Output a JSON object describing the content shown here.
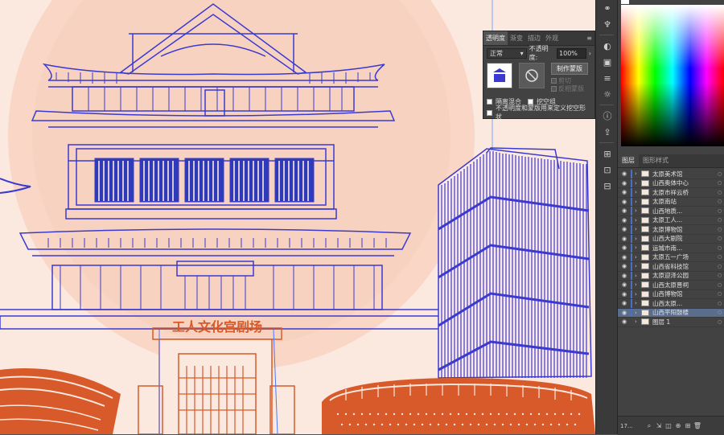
{
  "canvas": {
    "background": "#fbe8de",
    "sun_color": "#f9d6c5",
    "line_color": "#3a3ad0",
    "orange_color": "#d85a2a",
    "sign_text": "工人文化宫剧场"
  },
  "transparency_panel": {
    "tabs": [
      {
        "label": "透明度",
        "active": true
      },
      {
        "label": "渐变",
        "active": false
      },
      {
        "label": "描边",
        "active": false
      },
      {
        "label": "外观",
        "active": false
      }
    ],
    "menu_icon": "panel-menu-icon",
    "blend_mode": "正常",
    "opacity_label": "不透明度:",
    "opacity_value": "100%",
    "make_mask_label": "制作蒙版",
    "clip_label": "剪切",
    "invert_mask_label": "反相蒙版",
    "isolate_blending_label": "隔离混合",
    "knockout_group_label": "挖空组",
    "opacity_mask_define_label": "不透明度和蒙版用来定义挖空形状"
  },
  "toolbar": {
    "tools": [
      "link-icon",
      "puppet-icon",
      "color-icon",
      "swatch-icon",
      "stroke-icon",
      "sun-icon",
      "info-icon",
      "export-icon",
      "artboard-icon",
      "transform-icon",
      "align-icon"
    ]
  },
  "layers_panel": {
    "tabs": [
      {
        "label": "图层",
        "active": true
      },
      {
        "label": "图形样式",
        "active": false
      }
    ],
    "layers": [
      {
        "name": "太原美术馆",
        "selected": false,
        "sublayer": true
      },
      {
        "name": "山西奥体中心",
        "selected": false,
        "sublayer": true
      },
      {
        "name": "太原市祥云桥",
        "selected": false,
        "sublayer": true
      },
      {
        "name": "太原南站",
        "selected": false,
        "sublayer": true
      },
      {
        "name": "山西地质...",
        "selected": false,
        "sublayer": true
      },
      {
        "name": "太原工人...",
        "selected": false,
        "sublayer": true
      },
      {
        "name": "太原博物馆",
        "selected": false,
        "sublayer": true
      },
      {
        "name": "山西大剧院",
        "selected": false,
        "sublayer": true
      },
      {
        "name": "运城市南...",
        "selected": false,
        "sublayer": true
      },
      {
        "name": "太原五一广场",
        "selected": false,
        "sublayer": true
      },
      {
        "name": "山西省科技馆",
        "selected": false,
        "sublayer": true
      },
      {
        "name": "太原迎泽公园",
        "selected": false,
        "sublayer": true
      },
      {
        "name": "山西太原晋祠",
        "selected": false,
        "sublayer": true
      },
      {
        "name": "山西博物馆",
        "selected": false,
        "sublayer": true
      },
      {
        "name": "山西太原...",
        "selected": false,
        "sublayer": true
      },
      {
        "name": "山西平阳鼓楼",
        "selected": true,
        "sublayer": true
      },
      {
        "name": "图层 1",
        "selected": false,
        "sublayer": false
      }
    ],
    "count": "17..."
  }
}
